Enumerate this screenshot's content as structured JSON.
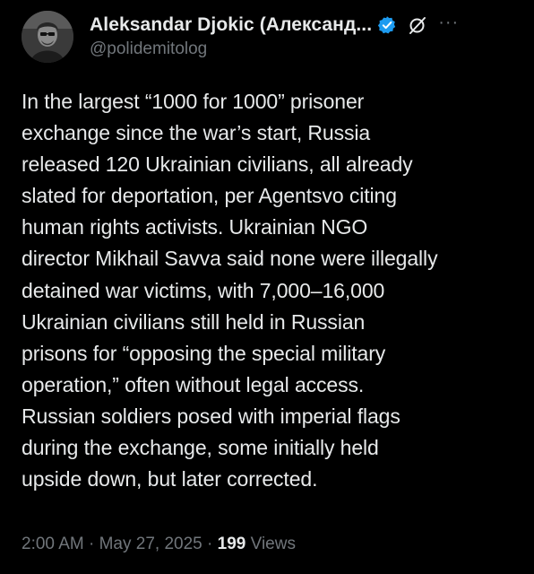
{
  "author": {
    "display_name": "Aleksandar Djokic (Александ...",
    "handle": "@polidemitolog"
  },
  "icons": {
    "verified": "verified-badge-icon",
    "grok": "grok-icon",
    "more": "more-options-icon"
  },
  "colors": {
    "background": "#000000",
    "text": "#e7e9ea",
    "muted": "#71767b",
    "verified": "#1d9bf0"
  },
  "more_label": "···",
  "tweet_lines": [
    "In the largest “1000 for 1000” prisoner",
    "exchange since the war’s start, Russia",
    "released 120 Ukrainian civilians, all already",
    "slated for deportation, per Agentsvo citing",
    "human rights activists. Ukrainian NGO",
    "director Mikhail Savva said none were illegally",
    "detained war victims, with 7,000–16,000",
    "Ukrainian civilians still held in Russian",
    "prisons for “opposing the special military",
    "operation,” often without legal access.",
    "Russian soldiers posed with imperial flags",
    "during the exchange, some initially held",
    "upside down, but later corrected."
  ],
  "meta": {
    "time": "2:00 AM",
    "separator": " · ",
    "date": "May 27, 2025",
    "separator2": " · ",
    "views_count": "199",
    "views_label": " Views"
  }
}
